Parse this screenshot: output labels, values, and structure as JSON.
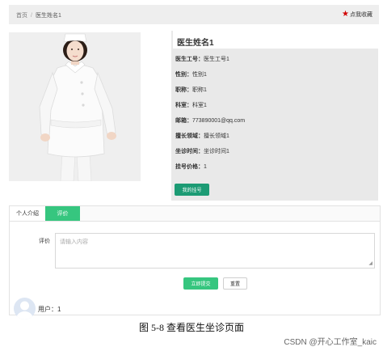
{
  "breadcrumb": {
    "home": "首页",
    "separator": "/",
    "current": "医生姓名1"
  },
  "favorite": {
    "label": "点我收藏",
    "icon": "star-icon",
    "icon_color": "#d10000"
  },
  "doctor": {
    "name": "医生姓名1",
    "fields": [
      {
        "key": "医生工号：",
        "value": "医生工号1"
      },
      {
        "key": "性别：",
        "value": "性别1"
      },
      {
        "key": "职称：",
        "value": "职称1"
      },
      {
        "key": "科室：",
        "value": "科室1"
      },
      {
        "key": "邮箱：",
        "value": "773890001@qq.com"
      },
      {
        "key": "擅长领域：",
        "value": "擅长领域1"
      },
      {
        "key": "坐诊时间：",
        "value": "坐诊时间1"
      },
      {
        "key": "挂号价格：",
        "value": "1"
      }
    ],
    "register_button": "我的挂号"
  },
  "tabs": [
    {
      "label": "个人介绍",
      "active": false
    },
    {
      "label": "评价",
      "active": true
    }
  ],
  "evaluation": {
    "label": "评价",
    "placeholder": "请输入内容",
    "submit_button": "立即提交",
    "reset_button": "重置"
  },
  "comment": {
    "user_label": "用户：1"
  },
  "caption": "图 5-8  查看医生坐诊页面",
  "watermark": "CSDN @开心工作室_kaic",
  "colors": {
    "accent_green": "#36c67f",
    "register_green": "#1c9b74",
    "star_red": "#d10000"
  }
}
